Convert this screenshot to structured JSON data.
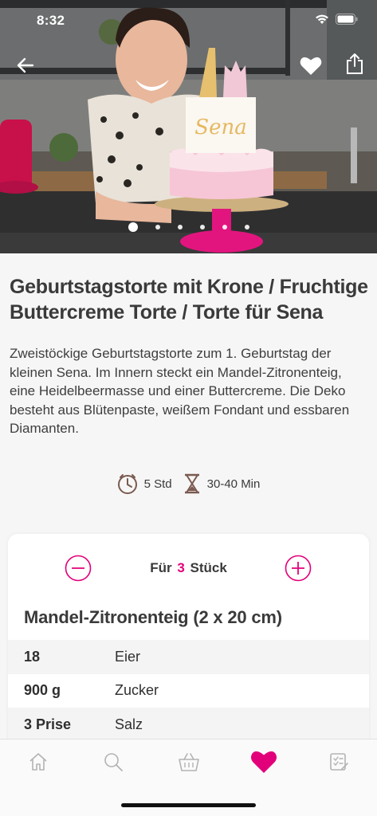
{
  "status_bar": {
    "time": "8:32"
  },
  "hero": {
    "cake_topper_text": "Sena",
    "carousel_count": 6,
    "carousel_active": 0
  },
  "recipe": {
    "title": "Geburtstagstorte mit Krone / Fruchtige Buttercreme Torte / Torte für Sena",
    "description": "Zweistöckige Geburtstagstorte zum 1. Geburtstag der kleinen Sena. Im Innern steckt ein Mandel-Zitronenteig, eine Heidelbeermasse und einer Buttercreme. Die Deko besteht aus Blütenpaste, weißem Fondant und essbaren Diamanten.",
    "prep_time": "5 Std",
    "bake_time": "30-40 Min"
  },
  "ingredients_card": {
    "servings_prefix": "Für",
    "servings_qty": "3",
    "servings_unit": "Stück",
    "section_title": "Mandel-Zitronenteig (2 x 20 cm)",
    "rows": [
      {
        "amount": "18",
        "name": "Eier"
      },
      {
        "amount": "900 g",
        "name": "Zucker"
      },
      {
        "amount": "3 Prise",
        "name": "Salz"
      }
    ]
  },
  "tabbar": {
    "tabs": [
      "home-icon",
      "search-icon",
      "basket-icon",
      "heart-icon",
      "checklist-icon"
    ],
    "active_tab": 3
  },
  "colors": {
    "accent": "#e2007a",
    "inactive_icon": "#b3b3b3",
    "text": "#3a3a3a"
  }
}
